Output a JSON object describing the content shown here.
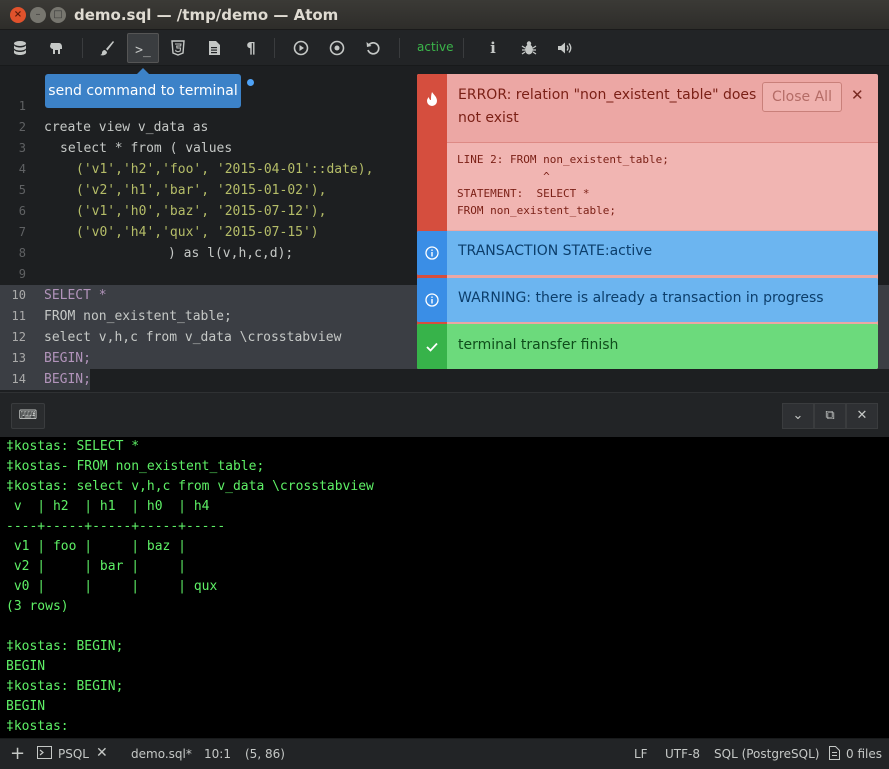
{
  "window": {
    "title": "demo.sql — /tmp/demo — Atom",
    "close": "×",
    "minimize": "–",
    "maximize": "□"
  },
  "toolbar": {
    "tooltip": "send command to terminal",
    "status": "active",
    "icons": [
      "database-icon",
      "elephant-icon",
      "brush-icon",
      "terminal-icon",
      "html5-icon",
      "file-icon",
      "pilcrow-icon",
      "play-icon",
      "stop-icon",
      "refresh-icon",
      "info-icon",
      "bug-icon",
      "volume-icon"
    ]
  },
  "editor": {
    "lines": [
      {
        "n": "1",
        "text": ""
      },
      {
        "n": "2",
        "text": "create view v_data as"
      },
      {
        "n": "3",
        "text": "select * from ( values"
      },
      {
        "n": "4",
        "text": "('v1','h2','foo', '2015-04-01'::date),"
      },
      {
        "n": "5",
        "text": "('v2','h1','bar', '2015-01-02'),"
      },
      {
        "n": "6",
        "text": "('v1','h0','baz', '2015-07-12'),"
      },
      {
        "n": "7",
        "text": "('v0','h4','qux', '2015-07-15')"
      },
      {
        "n": "8",
        "text": ") as l(v,h,c,d);"
      },
      {
        "n": "9",
        "text": ""
      },
      {
        "n": "10",
        "text": "SELECT *"
      },
      {
        "n": "11",
        "text": "FROM non_existent_table;"
      },
      {
        "n": "12",
        "text": "select v,h,c from v_data \\crosstabview"
      },
      {
        "n": "13",
        "text": "BEGIN;"
      },
      {
        "n": "14",
        "text": "BEGIN;"
      }
    ]
  },
  "notifications": {
    "error": {
      "message": "ERROR: relation \"non_existent_table\" does not exist",
      "detail": "LINE 2: FROM non_existent_table;\n             ^\nSTATEMENT:  SELECT *\nFROM non_existent_table;",
      "close_all": "Close All",
      "close": "✕"
    },
    "info1": "TRANSACTION STATE:active",
    "info2": "WARNING: there is already a transaction in progress",
    "success": "terminal transfer finish"
  },
  "panel": {
    "keyboard": "⌨",
    "collapse": "⌄",
    "maximize": "⧉",
    "close": "✕"
  },
  "terminal": {
    "lines": [
      "‡kostas: SELECT *",
      "‡kostas- FROM non_existent_table;",
      "‡kostas: select v,h,c from v_data \\crosstabview",
      " v  | h2  | h1  | h0  | h4",
      "----+-----+-----+-----+-----",
      " v1 | foo |     | baz |",
      " v2 |     | bar |     |",
      " v0 |     |     |     | qux",
      "(3 rows)",
      "",
      "‡kostas: BEGIN;",
      "BEGIN",
      "‡kostas: BEGIN;",
      "BEGIN",
      "‡kostas: "
    ]
  },
  "statusbar": {
    "add": "+",
    "terminal_name": "PSQL",
    "close": "✕",
    "file": "demo.sql*",
    "cursor": "10:1",
    "selection": "(5, 86)",
    "line_ending": "LF",
    "encoding": "UTF-8",
    "grammar": "SQL (PostgreSQL)",
    "files": "0 files"
  }
}
